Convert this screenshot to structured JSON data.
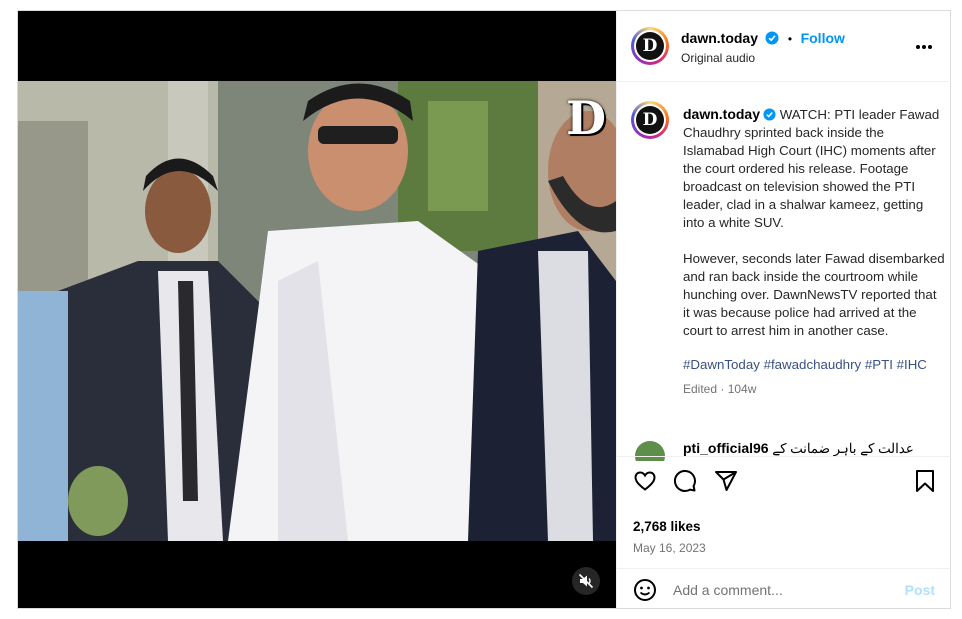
{
  "media": {
    "watermark": "D",
    "mute_icon": "speaker-muted-icon"
  },
  "header": {
    "username": "dawn.today",
    "separator": "•",
    "follow_label": "Follow",
    "subtitle": "Original audio",
    "more_icon": "more-horizontal-icon",
    "more_label": "..."
  },
  "caption": {
    "username": "dawn.today",
    "paragraph1": "WATCH: PTI leader Fawad Chaudhry sprinted back inside the Islamabad High Court (IHC) moments after the court ordered his release. Footage broadcast on television showed the PTI leader, clad in a shalwar kameez, getting into a white SUV.",
    "paragraph2": "However, seconds later Fawad disembarked and ran back inside the courtroom while hunching over. DawnNewsTV reported that it was because police had arrived at the court to arrest him in another case.",
    "hashtags": "#DawnToday #fawadchaudhry #PTI #IHC",
    "edited": "Edited · 104w"
  },
  "comment_preview": {
    "username": "pti_official96",
    "text": "عدالت کے باہر ضمانت کے"
  },
  "actions": {
    "likes": "2,768 likes",
    "date": "May 16, 2023"
  },
  "add_comment": {
    "placeholder": "Add a comment...",
    "post_label": "Post"
  },
  "colors": {
    "accent": "#0095f6",
    "border": "#dbdbdb",
    "muted_text": "#737373"
  }
}
